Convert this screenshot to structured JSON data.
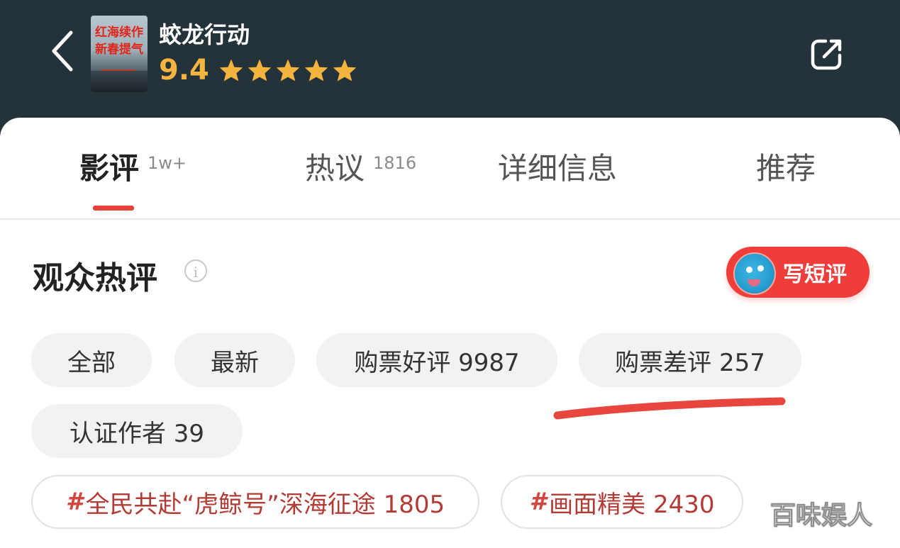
{
  "header": {
    "poster_text": [
      "红海续作",
      "新春提气"
    ],
    "title": "蛟龙行动",
    "rating": "9.4",
    "stars": 5,
    "colors": {
      "rating": "#f5b43d",
      "background": "#24323a"
    }
  },
  "tabs": [
    {
      "label": "影评",
      "count": "1w+",
      "active": true
    },
    {
      "label": "热议",
      "count": "1816",
      "active": false
    },
    {
      "label": "详细信息",
      "count": "",
      "active": false
    },
    {
      "label": "推荐",
      "count": "",
      "active": false
    }
  ],
  "section": {
    "title": "观众热评",
    "info_glyph": "i",
    "write_button": "写短评"
  },
  "filters": [
    "全部",
    "最新",
    "购票好评 9987",
    "购票差评 257",
    "认证作者 39"
  ],
  "topics": [
    {
      "hash": "#",
      "label": "全民共赴“虎鲸号”深海征途 1805"
    },
    {
      "hash": "#",
      "label": "画面精美 2430"
    }
  ],
  "watermark": "百味娱人",
  "accent_color": "#e7413a"
}
